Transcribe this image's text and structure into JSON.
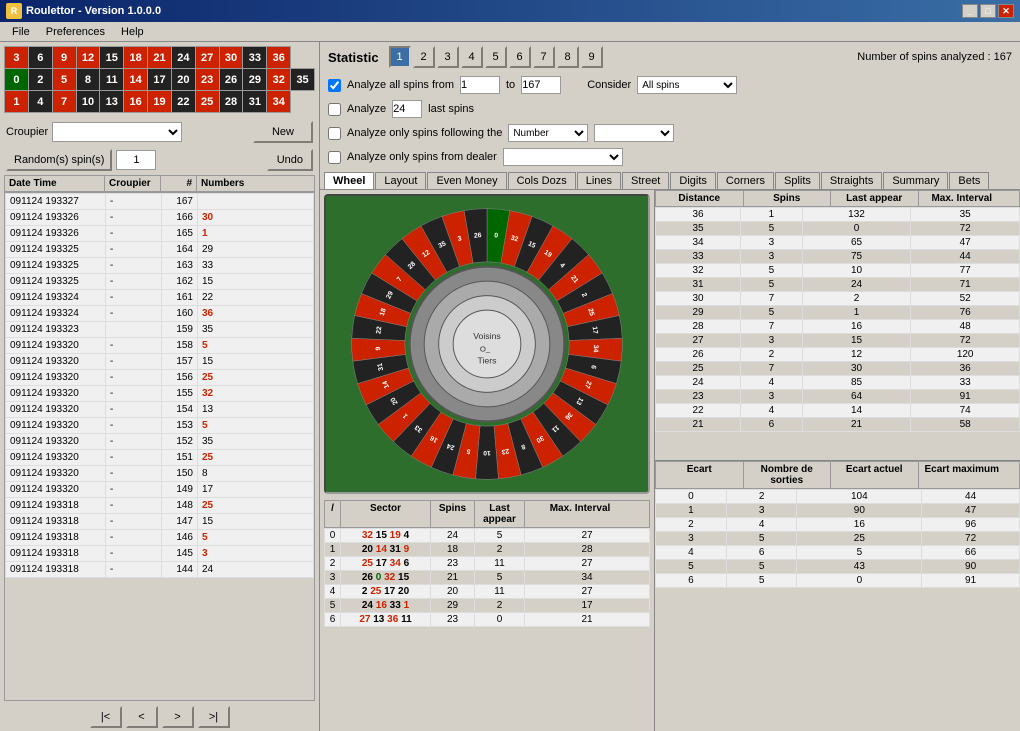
{
  "titleBar": {
    "title": "Roulettor - Version 1.0.0.0",
    "buttons": [
      "_",
      "□",
      "X"
    ]
  },
  "menu": {
    "items": [
      "File",
      "Preferences",
      "Help"
    ]
  },
  "controls": {
    "croupierLabel": "Croupier",
    "newLabel": "New",
    "randomSpinsLabel": "Random(s) spin(s)",
    "spinCount": "1",
    "undoLabel": "Undo"
  },
  "statistic": {
    "title": "Statistic",
    "tabs": [
      "1",
      "2",
      "3",
      "4",
      "5",
      "6",
      "7",
      "8",
      "9"
    ],
    "activeTab": "1",
    "spinInfo": "Number of spins analyzed : 167",
    "analyzeAllFrom": "Analyze all spins from",
    "fromValue": "1",
    "toValue": "167",
    "considerLabel": "Consider",
    "considerValue": "All spins",
    "analyzeLabel": "Analyze",
    "analyzeCount": "24",
    "lastSpins": "last spins",
    "analyzeFollowing": "Analyze only spins following the",
    "followingType": "Number",
    "analyzeFromDealer": "Analyze only spins from dealer"
  },
  "mainTabs": [
    "Wheel",
    "Layout",
    "Even Money",
    "Cols Dozs",
    "Lines",
    "Street",
    "Digits",
    "Corners",
    "Splits",
    "Straights",
    "Summary",
    "Bets"
  ],
  "activeMainTab": "Wheel",
  "wheelLabels": {
    "voisins": "Voisins",
    "tiers": "Tiers",
    "center": "O_"
  },
  "wheelNumbers": [
    {
      "n": "0",
      "color": "green"
    },
    {
      "n": "32",
      "color": "red"
    },
    {
      "n": "15",
      "color": "black"
    },
    {
      "n": "19",
      "color": "red"
    },
    {
      "n": "4",
      "color": "black"
    },
    {
      "n": "21",
      "color": "red"
    },
    {
      "n": "2",
      "color": "black"
    },
    {
      "n": "25",
      "color": "red"
    },
    {
      "n": "17",
      "color": "black"
    },
    {
      "n": "34",
      "color": "red"
    },
    {
      "n": "6",
      "color": "black"
    },
    {
      "n": "27",
      "color": "red"
    },
    {
      "n": "13",
      "color": "black"
    },
    {
      "n": "36",
      "color": "red"
    },
    {
      "n": "11",
      "color": "black"
    },
    {
      "n": "30",
      "color": "red"
    },
    {
      "n": "8",
      "color": "black"
    },
    {
      "n": "23",
      "color": "red"
    },
    {
      "n": "10",
      "color": "black"
    },
    {
      "n": "5",
      "color": "red"
    },
    {
      "n": "24",
      "color": "black"
    },
    {
      "n": "16",
      "color": "red"
    },
    {
      "n": "33",
      "color": "black"
    },
    {
      "n": "1",
      "color": "red"
    },
    {
      "n": "20",
      "color": "black"
    },
    {
      "n": "14",
      "color": "red"
    },
    {
      "n": "31",
      "color": "black"
    },
    {
      "n": "9",
      "color": "red"
    },
    {
      "n": "22",
      "color": "black"
    },
    {
      "n": "18",
      "color": "red"
    },
    {
      "n": "29",
      "color": "black"
    },
    {
      "n": "7",
      "color": "red"
    },
    {
      "n": "28",
      "color": "black"
    },
    {
      "n": "12",
      "color": "red"
    },
    {
      "n": "35",
      "color": "black"
    },
    {
      "n": "3",
      "color": "red"
    },
    {
      "n": "26",
      "color": "black"
    }
  ],
  "tableHeaders": [
    "Date Time",
    "Croupier",
    "#",
    "Numbers"
  ],
  "tableData": [
    {
      "dt": "091124 193327",
      "croupier": "-",
      "num": "167",
      "numbers": "",
      "color": "black"
    },
    {
      "dt": "091124 193326",
      "croupier": "-",
      "num": "166",
      "numbers": "30",
      "color": "red"
    },
    {
      "dt": "091124 193326",
      "croupier": "-",
      "num": "165",
      "numbers": "1",
      "color": "red"
    },
    {
      "dt": "091124 193325",
      "croupier": "-",
      "num": "164",
      "numbers": "29",
      "color": "black"
    },
    {
      "dt": "091124 193325",
      "croupier": "-",
      "num": "163",
      "numbers": "33",
      "color": "black"
    },
    {
      "dt": "091124 193325",
      "croupier": "-",
      "num": "162",
      "numbers": "15",
      "color": "black"
    },
    {
      "dt": "091124 193324",
      "croupier": "-",
      "num": "161",
      "numbers": "22",
      "color": "black"
    },
    {
      "dt": "091124 193324",
      "croupier": "-",
      "num": "160",
      "numbers": "36",
      "color": "red"
    },
    {
      "dt": "091124 193323",
      "coupier": "-",
      "num": "159",
      "numbers": "35",
      "color": "black"
    },
    {
      "dt": "091124 193320",
      "croupier": "-",
      "num": "158",
      "numbers": "5",
      "color": "red"
    },
    {
      "dt": "091124 193320",
      "croupier": "-",
      "num": "157",
      "numbers": "15",
      "color": "black"
    },
    {
      "dt": "091124 193320",
      "croupier": "-",
      "num": "156",
      "numbers": "25",
      "color": "red"
    },
    {
      "dt": "091124 193320",
      "croupier": "-",
      "num": "155",
      "numbers": "32",
      "color": "red"
    },
    {
      "dt": "091124 193320",
      "croupier": "-",
      "num": "154",
      "numbers": "13",
      "color": "black"
    },
    {
      "dt": "091124 193320",
      "croupier": "-",
      "num": "153",
      "numbers": "5",
      "color": "red"
    },
    {
      "dt": "091124 193320",
      "croupier": "-",
      "num": "152",
      "numbers": "35",
      "color": "black"
    },
    {
      "dt": "091124 193320",
      "croupier": "-",
      "num": "151",
      "numbers": "25",
      "color": "red"
    },
    {
      "dt": "091124 193320",
      "croupier": "-",
      "num": "150",
      "numbers": "8",
      "color": "black"
    },
    {
      "dt": "091124 193320",
      "croupier": "-",
      "num": "149",
      "numbers": "17",
      "color": "black"
    },
    {
      "dt": "091124 193318",
      "croupier": "-",
      "num": "148",
      "numbers": "25",
      "color": "red"
    },
    {
      "dt": "091124 193318",
      "croupier": "-",
      "num": "147",
      "numbers": "15",
      "color": "black"
    },
    {
      "dt": "091124 193318",
      "croupier": "-",
      "num": "146",
      "numbers": "5",
      "color": "red"
    },
    {
      "dt": "091124 193318",
      "croupier": "-",
      "num": "145",
      "numbers": "3",
      "color": "red"
    },
    {
      "dt": "091124 193318",
      "croupier": "-",
      "num": "144",
      "numbers": "24",
      "color": "black"
    }
  ],
  "pageButtons": [
    "|<",
    "<",
    ">",
    ">|"
  ],
  "bottomTable": {
    "headers": [
      "/",
      "Sector",
      "Spins",
      "Last appear",
      "Max. Interval"
    ],
    "rows": [
      {
        "idx": "0",
        "sector": "32 15 19 4",
        "spins": "24",
        "last": "5",
        "max": "27"
      },
      {
        "idx": "1",
        "sector": "20 14 31 9",
        "spins": "18",
        "last": "2",
        "max": "28"
      },
      {
        "idx": "2",
        "sector": "25 17 34 6",
        "spins": "23",
        "last": "11",
        "max": "27"
      },
      {
        "idx": "3",
        "sector": "26 0 32 15",
        "spins": "21",
        "last": "5",
        "max": "34"
      },
      {
        "idx": "4",
        "sector": "2 25 17 20",
        "spins": "20",
        "last": "11",
        "max": "27"
      },
      {
        "idx": "5",
        "sector": "24 16 33 1",
        "spins": "29",
        "last": "2",
        "max": "17"
      },
      {
        "idx": "6",
        "sector": "27 13 36 11",
        "spins": "23",
        "last": "0",
        "max": "21"
      }
    ]
  },
  "rightTopTable": {
    "headers": [
      "Distance",
      "Spins",
      "Last appear",
      "Max. Interval"
    ],
    "rows": [
      {
        "dist": "36",
        "spins": "1",
        "last": "132",
        "max": "35"
      },
      {
        "dist": "35",
        "spins": "5",
        "last": "0",
        "max": "72"
      },
      {
        "dist": "34",
        "spins": "3",
        "last": "65",
        "max": "47"
      },
      {
        "dist": "33",
        "spins": "3",
        "last": "75",
        "max": "44"
      },
      {
        "dist": "32",
        "spins": "5",
        "last": "10",
        "max": "77"
      },
      {
        "dist": "31",
        "spins": "5",
        "last": "24",
        "max": "71"
      },
      {
        "dist": "30",
        "spins": "7",
        "last": "2",
        "max": "52"
      },
      {
        "dist": "29",
        "spins": "5",
        "last": "1",
        "max": "76"
      },
      {
        "dist": "28",
        "spins": "7",
        "last": "16",
        "max": "48"
      },
      {
        "dist": "27",
        "spins": "3",
        "last": "15",
        "max": "72"
      },
      {
        "dist": "26",
        "spins": "2",
        "last": "12",
        "max": "120"
      },
      {
        "dist": "25",
        "spins": "7",
        "last": "30",
        "max": "36"
      },
      {
        "dist": "24",
        "spins": "4",
        "last": "85",
        "max": "33"
      },
      {
        "dist": "23",
        "spins": "3",
        "last": "64",
        "max": "91"
      },
      {
        "dist": "22",
        "spins": "4",
        "last": "14",
        "max": "74"
      },
      {
        "dist": "21",
        "spins": "6",
        "last": "21",
        "max": "58"
      }
    ]
  },
  "rightBottomTable": {
    "headers": [
      "Ecart",
      "Nombre de sorties",
      "Ecart actuel",
      "Ecart maximum"
    ],
    "rows": [
      {
        "ecart": "0",
        "sorties": "2",
        "actuel": "104",
        "max": "44"
      },
      {
        "ecart": "1",
        "sorties": "3",
        "actuel": "90",
        "max": "47"
      },
      {
        "ecart": "2",
        "sorties": "4",
        "actuel": "16",
        "max": "96"
      },
      {
        "ecart": "3",
        "sorties": "5",
        "actuel": "25",
        "max": "72"
      },
      {
        "ecart": "4",
        "sorties": "6",
        "actuel": "5",
        "max": "66"
      },
      {
        "ecart": "5",
        "sorties": "5",
        "actuel": "43",
        "max": "90"
      },
      {
        "ecart": "6",
        "sorties": "5",
        "actuel": "0",
        "max": "91"
      }
    ]
  },
  "numberGrid": {
    "row1": [
      {
        "n": "3",
        "c": "red"
      },
      {
        "n": "6",
        "c": "black"
      },
      {
        "n": "9",
        "c": "red"
      },
      {
        "n": "12",
        "c": "red"
      },
      {
        "n": "15",
        "c": "black"
      },
      {
        "n": "18",
        "c": "red"
      },
      {
        "n": "21",
        "c": "red"
      },
      {
        "n": "24",
        "c": "black"
      },
      {
        "n": "27",
        "c": "red"
      },
      {
        "n": "30",
        "c": "red"
      },
      {
        "n": "33",
        "c": "black"
      },
      {
        "n": "36",
        "c": "red"
      }
    ],
    "row2": [
      {
        "n": "0",
        "c": "green"
      },
      {
        "n": "2",
        "c": "black"
      },
      {
        "n": "5",
        "c": "red"
      },
      {
        "n": "8",
        "c": "black"
      },
      {
        "n": "11",
        "c": "black"
      },
      {
        "n": "14",
        "c": "red"
      },
      {
        "n": "17",
        "c": "black"
      },
      {
        "n": "20",
        "c": "black"
      },
      {
        "n": "23",
        "c": "red"
      },
      {
        "n": "26",
        "c": "black"
      },
      {
        "n": "29",
        "c": "black"
      },
      {
        "n": "32",
        "c": "red"
      },
      {
        "n": "35",
        "c": "black"
      }
    ],
    "row3": [
      {
        "n": "1",
        "c": "red"
      },
      {
        "n": "4",
        "c": "black"
      },
      {
        "n": "7",
        "c": "red"
      },
      {
        "n": "10",
        "c": "black"
      },
      {
        "n": "13",
        "c": "black"
      },
      {
        "n": "16",
        "c": "red"
      },
      {
        "n": "19",
        "c": "red"
      },
      {
        "n": "22",
        "c": "black"
      },
      {
        "n": "25",
        "c": "red"
      },
      {
        "n": "28",
        "c": "black"
      },
      {
        "n": "31",
        "c": "black"
      },
      {
        "n": "34",
        "c": "red"
      }
    ]
  }
}
